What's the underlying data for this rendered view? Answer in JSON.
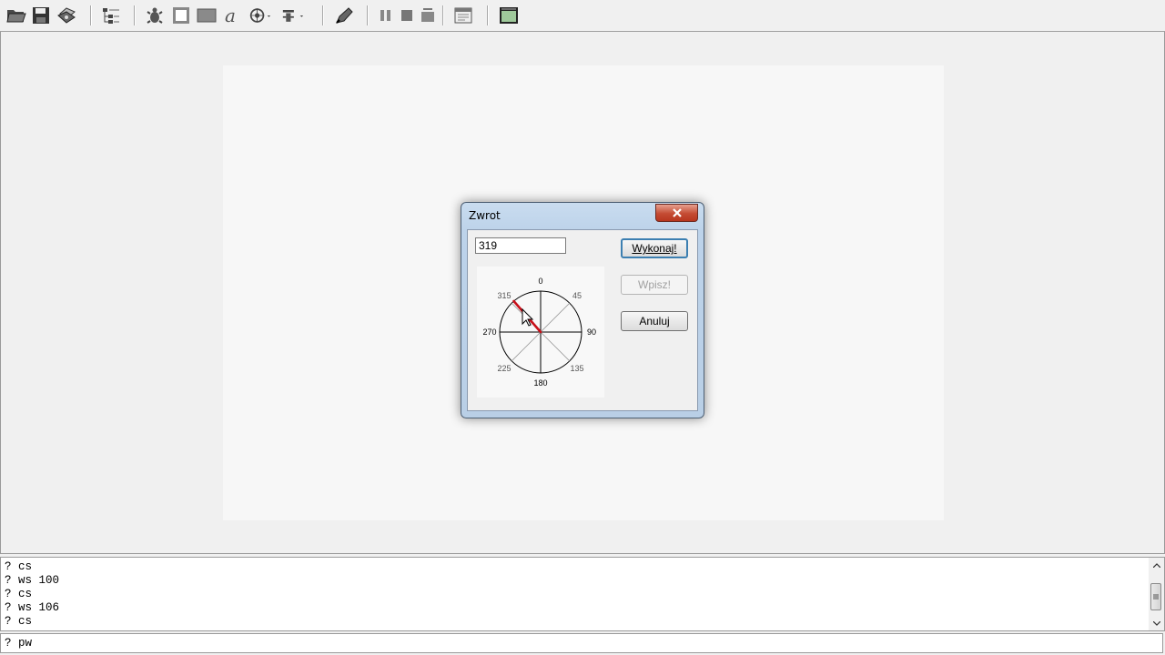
{
  "toolbar": {
    "icons": [
      "open-folder-icon",
      "save-icon",
      "print-icon",
      "tree-structure-icon",
      "turtle-icon",
      "frame-icon",
      "fill-rectangle-icon",
      "text-font-icon",
      "pen-target-icon",
      "pen-width-icon",
      "edit-brush-icon",
      "pause-icon",
      "stop-icon",
      "step-run-icon",
      "window-settings-icon",
      "picture-view-icon"
    ]
  },
  "dialog": {
    "title": "Zwrot",
    "angle_value": "319",
    "buttons": {
      "execute": "Wykonaj!",
      "insert": "Wpisz!",
      "cancel": "Anuluj"
    },
    "compass": {
      "labels": [
        "0",
        "45",
        "90",
        "135",
        "180",
        "225",
        "270",
        "315"
      ],
      "pointer_angle_deg": 319,
      "pointer_color": "#c8101a"
    }
  },
  "console": {
    "lines": [
      "? cs",
      "? ws 100",
      "? cs",
      "? ws 106",
      "? cs"
    ]
  },
  "command_input": {
    "value": "? pw"
  },
  "colors": {
    "dialog_frame": "#bdd3ea",
    "close_button": "#c44b33",
    "default_button_border": "#3c7fb1"
  }
}
